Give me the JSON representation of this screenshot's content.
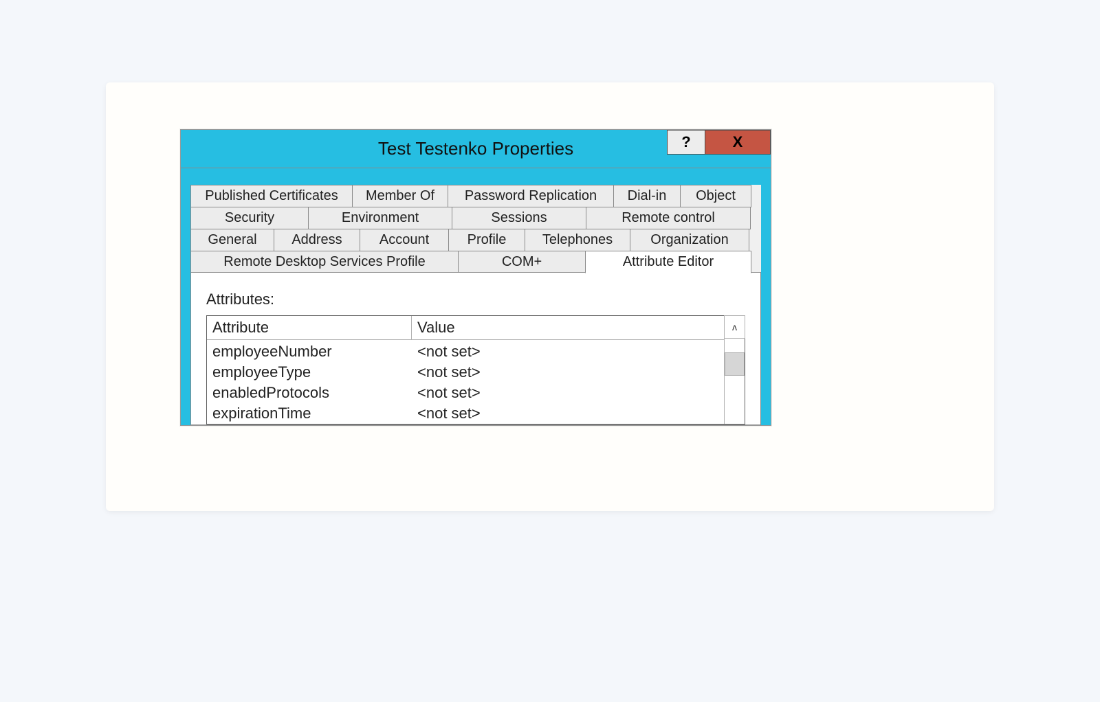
{
  "window": {
    "title": "Test Testenko Properties",
    "help_label": "?",
    "close_label": "X"
  },
  "tabs": {
    "row1": [
      "Published Certificates",
      "Member Of",
      "Password Replication",
      "Dial-in",
      "Object"
    ],
    "row2": [
      "Security",
      "Environment",
      "Sessions",
      "Remote control"
    ],
    "row3": [
      "General",
      "Address",
      "Account",
      "Profile",
      "Telephones",
      "Organization"
    ],
    "row4": [
      "Remote Desktop Services Profile",
      "COM+",
      "Attribute Editor"
    ],
    "active": "Attribute Editor"
  },
  "content": {
    "attributes_label": "Attributes:",
    "columns": {
      "attribute": "Attribute",
      "value": "Value"
    },
    "scroll_up_glyph": "ʌ",
    "rows": [
      {
        "attr": "employeeNumber",
        "val": "<not set>"
      },
      {
        "attr": "employeeType",
        "val": "<not set>"
      },
      {
        "attr": "enabledProtocols",
        "val": "<not set>"
      },
      {
        "attr": "expirationTime",
        "val": "<not set>"
      }
    ]
  }
}
